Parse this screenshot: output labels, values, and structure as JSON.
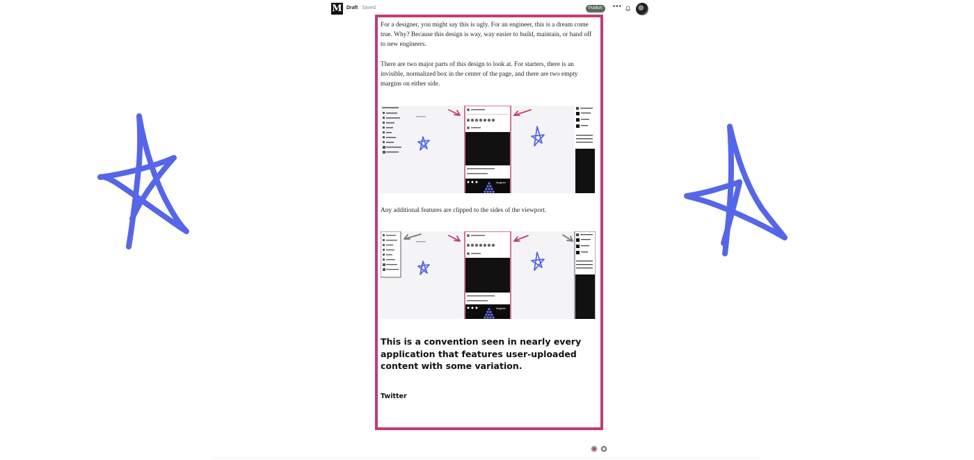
{
  "header": {
    "logo_letter": "M",
    "draft_label": "Draft",
    "saved_label": "Saved",
    "publish_label": "Publish",
    "more_label": "•••",
    "icons": [
      "bell-icon",
      "avatar"
    ]
  },
  "article": {
    "paragraphs": [
      "For a designer, you might say this is ugly. For an engineer, this is a dream come true. Why? Because this design is way, way easier to build, maintain, or hand off to new engineers.",
      "There are two major parts of this design to look at. For starters, there is an invisible, normalized box in the center of the page, and there are two empty margins on either side.",
      "Any additional features are clipped to the sides of the viewport."
    ],
    "heading": "This is a convention seen in nearly every application that features user-uploaded content with some variation.",
    "subheading": "Twitter",
    "figure_caption_1": "Aegean",
    "figure_caption_2": "Aegean"
  },
  "annotations": {
    "highlight_color": "#c43a76",
    "star_color": "#5566e8",
    "arrow_color_pink": "#c43a76",
    "arrow_color_gray": "#777777"
  }
}
